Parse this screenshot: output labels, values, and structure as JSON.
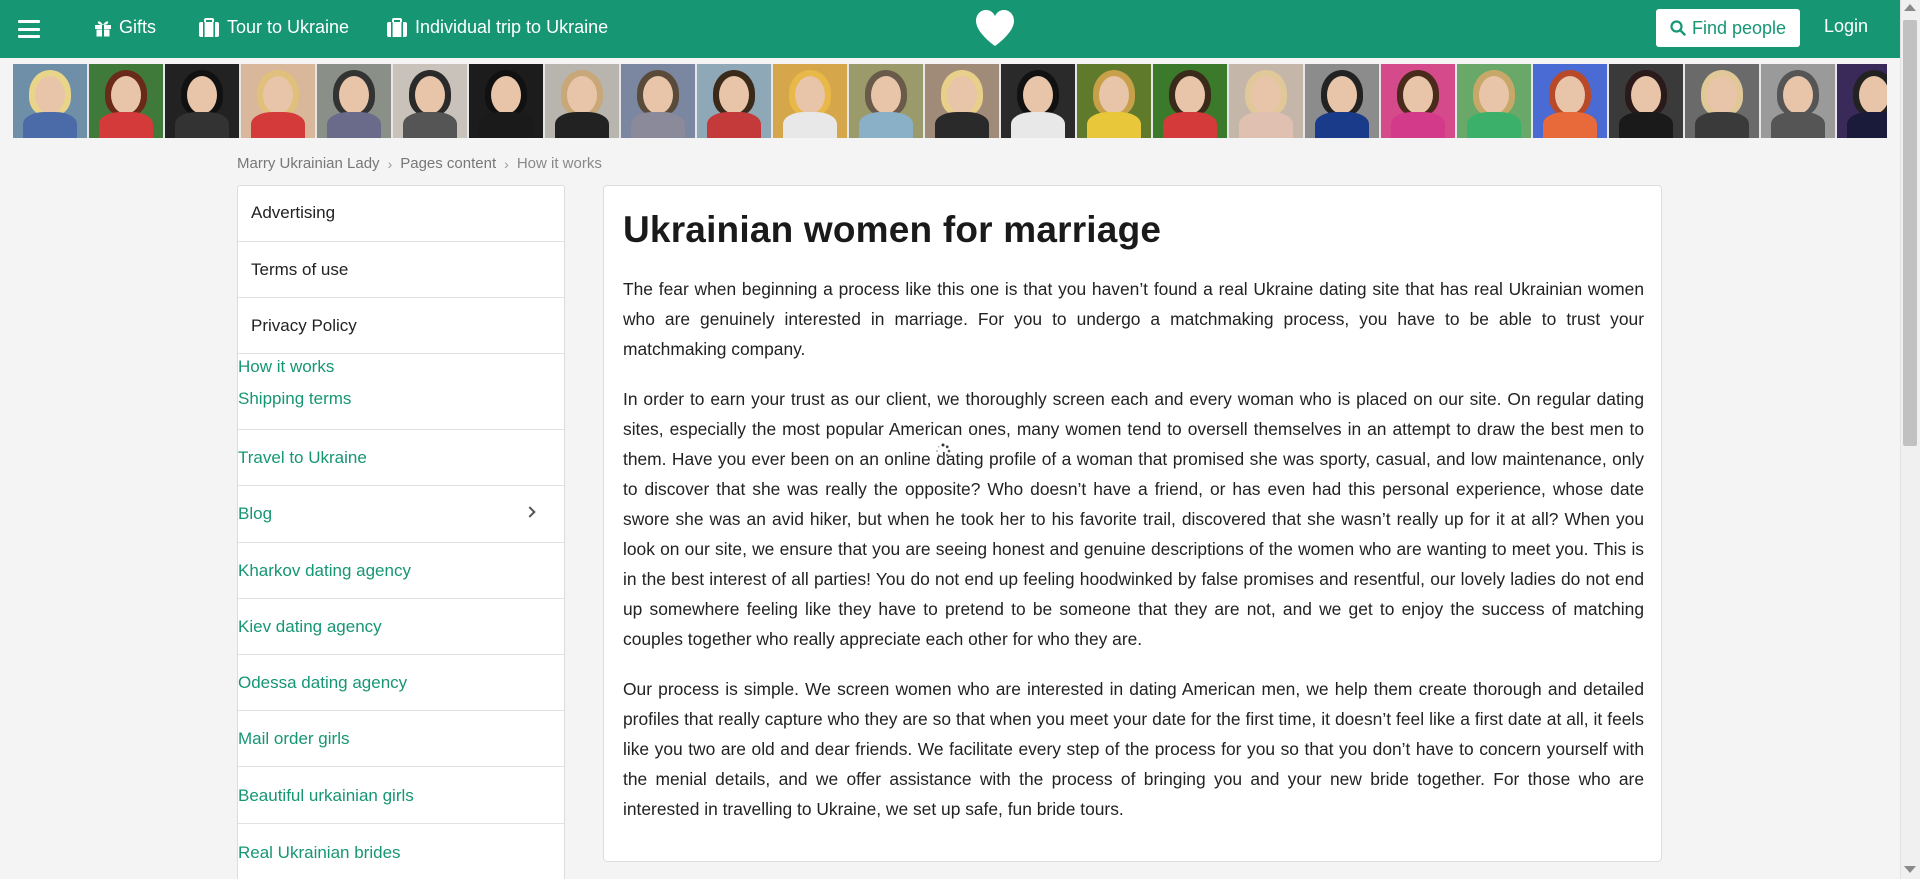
{
  "nav": {
    "gifts": "Gifts",
    "tour": "Tour to Ukraine",
    "individual": "Individual trip to Ukraine",
    "find_people": "Find people",
    "login": "Login",
    "brand_color": "#169673"
  },
  "photo_strip": {
    "count": 25
  },
  "breadcrumb": {
    "items": [
      "Marry Ukrainian Lady",
      "Pages content",
      "How it works"
    ]
  },
  "sidebar": {
    "items": [
      "Advertising",
      "Terms of use",
      "Privacy Policy",
      "How it works",
      "Shipping terms",
      "Travel to Ukraine",
      "Blog",
      "Kharkov dating agency",
      "Kiev dating agency",
      "Odessa dating agency",
      "Mail order girls",
      "Beautiful urkainian girls",
      "Real Ukrainian brides"
    ]
  },
  "main": {
    "title": "Ukrainian women for marriage",
    "paragraphs": [
      "The fear when beginning a process like this one is that you haven’t found a real Ukraine dating site that has real Ukrainian women who are genuinely interested in marriage. For you to undergo a matchmaking process, you have to be able to trust your matchmaking company.",
      "In order to earn your trust as our client, we thoroughly screen each and every woman who is placed on our site. On regular dating sites, especially the most popular American ones, many women tend to oversell themselves in an attempt to draw the best men to them. Have you ever been on an online dating profile of a woman that promised she was sporty, casual, and low maintenance, only to discover that she was really the opposite? Who doesn’t have a friend, or has even had this personal experience, whose date swore she was an avid hiker, but when he took her to his favorite trail, discovered that she wasn’t really up for it at all? When you look on our site, we ensure that you are seeing honest and genuine descriptions of the women who are wanting to meet you. This is in the best interest of all parties! You do not end up feeling hoodwinked by false promises and resentful, our lovely ladies do not end up somewhere feeling like they have to pretend to be someone that they are not, and we get to enjoy the success of matching couples together who really appreciate each other for who they are.",
      "Our process is simple. We screen women who are interested in dating American men, we help them create thorough and detailed profiles that really capture who they are so that when you meet your date for the first time, it doesn’t feel like a first date at all, it feels like you two are old and dear friends. We facilitate every step of the process for you so that you don’t have to concern yourself with the menial details, and we offer assistance with the process of bringing you and your new bride together. For those who are interested in travelling to Ukraine, we set up safe, fun bride tours."
    ]
  }
}
